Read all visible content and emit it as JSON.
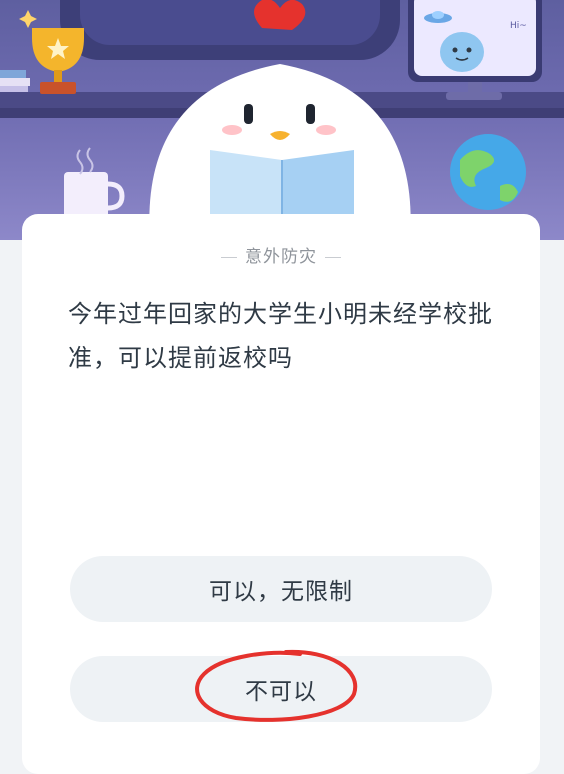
{
  "quiz": {
    "category": "意外防灾",
    "question": "今年过年回家的大学生小明未经学校批准，可以提前返校吗",
    "options": [
      {
        "label": "可以，无限制"
      },
      {
        "label": "不可以"
      }
    ]
  },
  "robot_speech": "Hi~",
  "colors": {
    "hero_bg": "#6f6cb1",
    "accent_red": "#e5322d",
    "option_bg": "#eef2f5",
    "text_primary": "#2f3a45"
  }
}
